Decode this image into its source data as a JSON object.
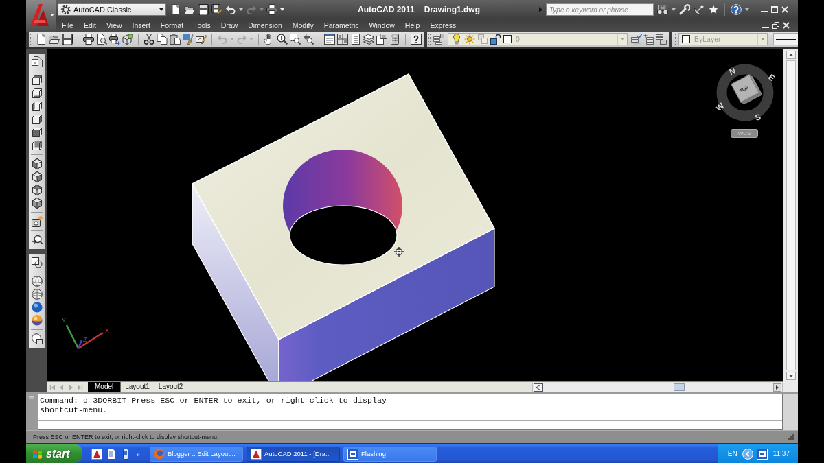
{
  "window": {
    "workspace": "AutoCAD Classic",
    "app_title": "AutoCAD 2011",
    "document_title": "Drawing1.dwg",
    "search": {
      "placeholder": "Type a keyword or phrase"
    }
  },
  "menu_bar": [
    "File",
    "Edit",
    "View",
    "Insert",
    "Format",
    "Tools",
    "Draw",
    "Dimension",
    "Modify",
    "Parametric",
    "Window",
    "Help",
    "Express"
  ],
  "layers_toolbar": {
    "layer": "0"
  },
  "properties_toolbar": {
    "current_value": "ByLayer"
  },
  "viewport": {
    "viewcube": {
      "face": "TOP",
      "compass": [
        "N",
        "E",
        "S",
        "W"
      ],
      "ucs": "WCS"
    },
    "ucs_axes": [
      "Y",
      "Z",
      "X"
    ]
  },
  "layout_tabs": [
    {
      "label": "Model",
      "selected": true
    },
    {
      "label": "Layout1",
      "selected": false
    },
    {
      "label": "Layout2",
      "selected": false
    }
  ],
  "command_line": {
    "history": "Command: q 3DORBIT Press ESC or ENTER to exit, or right-click to display shortcut-menu."
  },
  "status_bar": {
    "prompt": "Press ESC or ENTER to exit, or right-click to display shortcut-menu."
  },
  "taskbar": {
    "start": "start",
    "more": "»",
    "tasks": [
      {
        "label": "Blogger :: Edit Layout...",
        "selected": false
      },
      {
        "label": "AutoCAD 2011 - [Dra...",
        "selected": true
      },
      {
        "label": "Flashing",
        "selected": false
      }
    ],
    "language": "EN",
    "clock": "11:37"
  }
}
